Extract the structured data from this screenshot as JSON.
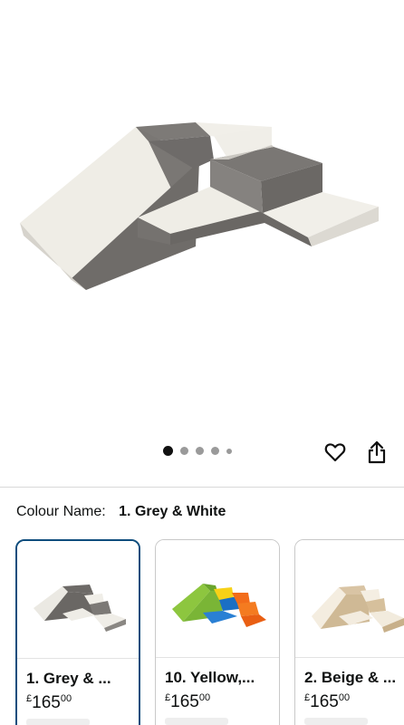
{
  "product": {
    "image_alt": "Grey and white soft play foam shapes",
    "gallery": {
      "count": 5,
      "active_index": 0
    }
  },
  "actions": {
    "favourite_icon": "heart-icon",
    "share_icon": "share-icon"
  },
  "colour": {
    "label": "Colour Name:",
    "selected": "1. Grey & White"
  },
  "swatches": [
    {
      "name": "1. Grey & ...",
      "price_symbol": "£",
      "price_whole": "165",
      "price_pence": "00",
      "selected": true
    },
    {
      "name": "10. Yellow,...",
      "price_symbol": "£",
      "price_whole": "165",
      "price_pence": "00",
      "selected": false
    },
    {
      "name": "2. Beige & ...",
      "price_symbol": "£",
      "price_whole": "165",
      "price_pence": "00",
      "selected": false
    }
  ]
}
